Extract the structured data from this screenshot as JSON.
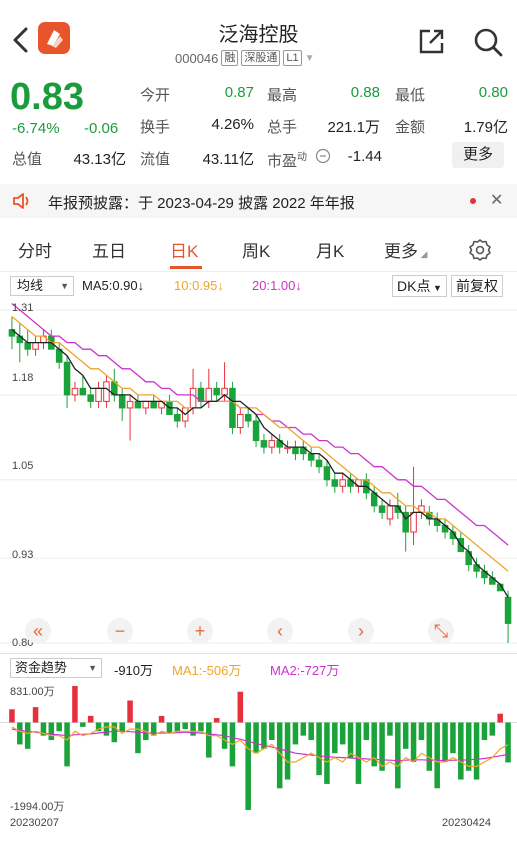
{
  "header": {
    "title": "泛海控股",
    "code": "000046",
    "tags": [
      "融",
      "深股通",
      "L1"
    ]
  },
  "quote": {
    "price": "0.83",
    "change_pct": "-6.74%",
    "change": "-0.06",
    "stats": [
      {
        "label": "今开",
        "value": "0.87",
        "color": "green"
      },
      {
        "label": "最高",
        "value": "0.88",
        "color": "green"
      },
      {
        "label": "最低",
        "value": "0.80",
        "color": "green"
      },
      {
        "label": "换手",
        "value": "4.26%"
      },
      {
        "label": "总手",
        "value": "221.1万"
      },
      {
        "label": "金额",
        "value": "1.79亿"
      },
      {
        "label": "总值",
        "value": "43.13亿"
      },
      {
        "label": "流值",
        "value": "43.11亿"
      },
      {
        "label": "市盈",
        "sup": "动",
        "value": "-1.44"
      }
    ],
    "more_label": "更多"
  },
  "notice": {
    "text": "年报预披露：于 2023-04-29 披露 2022 年年报"
  },
  "tabs": [
    "分时",
    "五日",
    "日K",
    "周K",
    "月K",
    "更多"
  ],
  "active_tab": "日K",
  "chart": {
    "indicator": "均线",
    "ma5": "MA5:0.90↓",
    "ma10": "10:0.95↓",
    "ma20": "20:1.00↓",
    "dk_label": "DK点",
    "fq_label": "前复权",
    "y_labels": [
      "1.31",
      "1.18",
      "1.05",
      "0.93",
      "0.80"
    ],
    "colors": {
      "up": "#e8303c",
      "down": "#1aa33a",
      "ma5": "#222222",
      "ma10": "#f0a52a",
      "ma20": "#cc33cc"
    }
  },
  "controls": [
    "«",
    "−",
    "+",
    "‹",
    "›",
    "⤡"
  ],
  "fund": {
    "indicator": "资金趋势",
    "value": "-910万",
    "ma1": "MA1:-506万",
    "ma2": "MA2:-727万",
    "max_label": "831.00万",
    "min_label": "-1994.00万",
    "start_date": "20230207",
    "end_date": "20230424"
  },
  "chart_data": {
    "type": "candlestick",
    "candles": [
      {
        "o": 1.28,
        "h": 1.3,
        "l": 1.25,
        "c": 1.27
      },
      {
        "o": 1.27,
        "h": 1.29,
        "l": 1.23,
        "c": 1.26
      },
      {
        "o": 1.26,
        "h": 1.28,
        "l": 1.24,
        "c": 1.25
      },
      {
        "o": 1.25,
        "h": 1.27,
        "l": 1.24,
        "c": 1.26
      },
      {
        "o": 1.26,
        "h": 1.28,
        "l": 1.25,
        "c": 1.27
      },
      {
        "o": 1.27,
        "h": 1.28,
        "l": 1.25,
        "c": 1.25
      },
      {
        "o": 1.25,
        "h": 1.26,
        "l": 1.22,
        "c": 1.23
      },
      {
        "o": 1.23,
        "h": 1.24,
        "l": 1.16,
        "c": 1.18
      },
      {
        "o": 1.18,
        "h": 1.2,
        "l": 1.17,
        "c": 1.19
      },
      {
        "o": 1.19,
        "h": 1.21,
        "l": 1.18,
        "c": 1.18
      },
      {
        "o": 1.18,
        "h": 1.19,
        "l": 1.16,
        "c": 1.17
      },
      {
        "o": 1.17,
        "h": 1.2,
        "l": 1.16,
        "c": 1.19
      },
      {
        "o": 1.17,
        "h": 1.21,
        "l": 1.16,
        "c": 1.2
      },
      {
        "o": 1.2,
        "h": 1.22,
        "l": 1.17,
        "c": 1.18
      },
      {
        "o": 1.18,
        "h": 1.19,
        "l": 1.14,
        "c": 1.16
      },
      {
        "o": 1.16,
        "h": 1.18,
        "l": 1.11,
        "c": 1.17
      },
      {
        "o": 1.17,
        "h": 1.18,
        "l": 1.16,
        "c": 1.16
      },
      {
        "o": 1.16,
        "h": 1.17,
        "l": 1.15,
        "c": 1.17
      },
      {
        "o": 1.17,
        "h": 1.18,
        "l": 1.16,
        "c": 1.16
      },
      {
        "o": 1.16,
        "h": 1.17,
        "l": 1.15,
        "c": 1.17
      },
      {
        "o": 1.17,
        "h": 1.18,
        "l": 1.15,
        "c": 1.15
      },
      {
        "o": 1.15,
        "h": 1.16,
        "l": 1.13,
        "c": 1.14
      },
      {
        "o": 1.14,
        "h": 1.16,
        "l": 1.13,
        "c": 1.16
      },
      {
        "o": 1.16,
        "h": 1.22,
        "l": 1.15,
        "c": 1.19
      },
      {
        "o": 1.19,
        "h": 1.2,
        "l": 1.16,
        "c": 1.17
      },
      {
        "o": 1.17,
        "h": 1.22,
        "l": 1.16,
        "c": 1.19
      },
      {
        "o": 1.19,
        "h": 1.2,
        "l": 1.17,
        "c": 1.18
      },
      {
        "o": 1.18,
        "h": 1.23,
        "l": 1.17,
        "c": 1.19
      },
      {
        "o": 1.19,
        "h": 1.2,
        "l": 1.12,
        "c": 1.13
      },
      {
        "o": 1.13,
        "h": 1.16,
        "l": 1.12,
        "c": 1.15
      },
      {
        "o": 1.15,
        "h": 1.16,
        "l": 1.13,
        "c": 1.14
      },
      {
        "o": 1.14,
        "h": 1.15,
        "l": 1.1,
        "c": 1.11
      },
      {
        "o": 1.11,
        "h": 1.12,
        "l": 1.09,
        "c": 1.1
      },
      {
        "o": 1.1,
        "h": 1.12,
        "l": 1.09,
        "c": 1.11
      },
      {
        "o": 1.11,
        "h": 1.12,
        "l": 1.09,
        "c": 1.1
      },
      {
        "o": 1.1,
        "h": 1.11,
        "l": 1.09,
        "c": 1.1
      },
      {
        "o": 1.1,
        "h": 1.11,
        "l": 1.08,
        "c": 1.09
      },
      {
        "o": 1.1,
        "h": 1.11,
        "l": 1.08,
        "c": 1.09
      },
      {
        "o": 1.09,
        "h": 1.1,
        "l": 1.07,
        "c": 1.08
      },
      {
        "o": 1.08,
        "h": 1.09,
        "l": 1.06,
        "c": 1.07
      },
      {
        "o": 1.07,
        "h": 1.08,
        "l": 1.04,
        "c": 1.05
      },
      {
        "o": 1.05,
        "h": 1.06,
        "l": 1.03,
        "c": 1.04
      },
      {
        "o": 1.04,
        "h": 1.06,
        "l": 1.03,
        "c": 1.05
      },
      {
        "o": 1.05,
        "h": 1.06,
        "l": 1.03,
        "c": 1.04
      },
      {
        "o": 1.04,
        "h": 1.05,
        "l": 1.03,
        "c": 1.05
      },
      {
        "o": 1.05,
        "h": 1.06,
        "l": 1.02,
        "c": 1.03
      },
      {
        "o": 1.03,
        "h": 1.04,
        "l": 1.0,
        "c": 1.01
      },
      {
        "o": 1.01,
        "h": 1.02,
        "l": 0.99,
        "c": 1.0
      },
      {
        "o": 0.99,
        "h": 1.02,
        "l": 0.98,
        "c": 1.01
      },
      {
        "o": 1.01,
        "h": 1.03,
        "l": 0.99,
        "c": 1.0
      },
      {
        "o": 1.0,
        "h": 1.01,
        "l": 0.94,
        "c": 0.97
      },
      {
        "o": 0.97,
        "h": 1.07,
        "l": 0.95,
        "c": 1.0
      },
      {
        "o": 1.0,
        "h": 1.02,
        "l": 0.99,
        "c": 1.01
      },
      {
        "o": 1.0,
        "h": 1.01,
        "l": 0.98,
        "c": 0.99
      },
      {
        "o": 0.99,
        "h": 1.0,
        "l": 0.97,
        "c": 0.98
      },
      {
        "o": 0.98,
        "h": 0.99,
        "l": 0.96,
        "c": 0.97
      },
      {
        "o": 0.97,
        "h": 0.98,
        "l": 0.95,
        "c": 0.96
      },
      {
        "o": 0.96,
        "h": 0.97,
        "l": 0.94,
        "c": 0.94
      },
      {
        "o": 0.94,
        "h": 0.95,
        "l": 0.91,
        "c": 0.92
      },
      {
        "o": 0.92,
        "h": 0.93,
        "l": 0.9,
        "c": 0.91
      },
      {
        "o": 0.91,
        "h": 0.92,
        "l": 0.89,
        "c": 0.9
      },
      {
        "o": 0.9,
        "h": 0.91,
        "l": 0.89,
        "c": 0.89
      },
      {
        "o": 0.89,
        "h": 0.89,
        "l": 0.88,
        "c": 0.88
      },
      {
        "o": 0.87,
        "h": 0.88,
        "l": 0.8,
        "c": 0.83
      }
    ],
    "ma5": [
      1.28,
      1.27,
      1.26,
      1.26,
      1.26,
      1.26,
      1.25,
      1.24,
      1.22,
      1.21,
      1.19,
      1.19,
      1.19,
      1.18,
      1.18,
      1.18,
      1.17,
      1.17,
      1.17,
      1.17,
      1.16,
      1.16,
      1.15,
      1.16,
      1.16,
      1.17,
      1.17,
      1.18,
      1.17,
      1.17,
      1.16,
      1.15,
      1.13,
      1.12,
      1.11,
      1.1,
      1.1,
      1.1,
      1.09,
      1.09,
      1.08,
      1.06,
      1.06,
      1.05,
      1.04,
      1.04,
      1.03,
      1.02,
      1.01,
      1.01,
      0.99,
      1.0,
      1.0,
      0.99,
      0.99,
      0.98,
      0.97,
      0.95,
      0.94,
      0.92,
      0.91,
      0.9,
      0.89,
      0.87
    ],
    "ma10": [
      1.3,
      1.29,
      1.28,
      1.27,
      1.27,
      1.26,
      1.26,
      1.25,
      1.24,
      1.23,
      1.22,
      1.22,
      1.21,
      1.2,
      1.19,
      1.19,
      1.18,
      1.18,
      1.18,
      1.17,
      1.17,
      1.17,
      1.16,
      1.16,
      1.16,
      1.17,
      1.17,
      1.17,
      1.17,
      1.16,
      1.16,
      1.16,
      1.15,
      1.14,
      1.13,
      1.13,
      1.12,
      1.11,
      1.1,
      1.1,
      1.09,
      1.08,
      1.07,
      1.06,
      1.05,
      1.05,
      1.04,
      1.03,
      1.03,
      1.02,
      1.01,
      1.01,
      1.0,
      1.0,
      0.99,
      0.99,
      0.98,
      0.97,
      0.96,
      0.95,
      0.94,
      0.93,
      0.92,
      0.91
    ],
    "ma20": [
      1.32,
      1.31,
      1.3,
      1.29,
      1.28,
      1.27,
      1.27,
      1.26,
      1.26,
      1.25,
      1.25,
      1.24,
      1.24,
      1.23,
      1.22,
      1.22,
      1.21,
      1.2,
      1.2,
      1.19,
      1.19,
      1.18,
      1.18,
      1.18,
      1.17,
      1.17,
      1.17,
      1.17,
      1.17,
      1.16,
      1.16,
      1.15,
      1.15,
      1.14,
      1.14,
      1.13,
      1.13,
      1.12,
      1.12,
      1.11,
      1.11,
      1.1,
      1.1,
      1.09,
      1.09,
      1.08,
      1.07,
      1.07,
      1.06,
      1.05,
      1.05,
      1.04,
      1.04,
      1.03,
      1.02,
      1.02,
      1.01,
      1.0,
      0.99,
      0.98,
      0.98,
      0.97,
      0.96,
      0.95
    ],
    "ylim": [
      0.8,
      1.31
    ],
    "fund_flow": [
      300,
      -500,
      -600,
      350,
      -300,
      -400,
      -200,
      -1000,
      831,
      -100,
      150,
      -200,
      -300,
      -450,
      -200,
      500,
      -700,
      -400,
      -300,
      150,
      -250,
      -200,
      -150,
      -300,
      -200,
      -800,
      100,
      -600,
      -1000,
      700,
      -1994,
      -700,
      -600,
      -400,
      -1500,
      -1300,
      -500,
      -300,
      -400,
      -1200,
      -1400,
      -700,
      -500,
      -800,
      -1400,
      -400,
      -1000,
      -1100,
      -300,
      -1500,
      -600,
      -900,
      -400,
      -1100,
      -1500,
      -900,
      -700,
      -1300,
      -1100,
      -1300,
      -400,
      -300,
      200,
      -910
    ],
    "fund_ma1": [
      -100,
      -200,
      -250,
      -200,
      -250,
      -300,
      -300,
      -400,
      -200,
      -300,
      -250,
      -150,
      -100,
      -100,
      -250,
      -150,
      -150,
      -200,
      -300,
      -200,
      -250,
      -200,
      -200,
      -200,
      -200,
      -300,
      -300,
      -400,
      -500,
      -400,
      -600,
      -700,
      -600,
      -500,
      -700,
      -900,
      -900,
      -800,
      -700,
      -800,
      -900,
      -800,
      -900,
      -700,
      -800,
      -900,
      -800,
      -1000,
      -900,
      -1000,
      -800,
      -900,
      -700,
      -800,
      -900,
      -900,
      -800,
      -900,
      -1000,
      -1000,
      -900,
      -800,
      -600,
      -506
    ],
    "fund_ma2": [
      -150,
      -180,
      -200,
      -220,
      -250,
      -270,
      -280,
      -300,
      -280,
      -270,
      -260,
      -240,
      -220,
      -200,
      -200,
      -210,
      -220,
      -230,
      -250,
      -240,
      -240,
      -230,
      -220,
      -230,
      -240,
      -260,
      -280,
      -300,
      -350,
      -380,
      -430,
      -480,
      -520,
      -560,
      -600,
      -650,
      -700,
      -720,
      -740,
      -760,
      -780,
      -790,
      -800,
      -810,
      -820,
      -830,
      -840,
      -850,
      -860,
      -870,
      -860,
      -850,
      -850,
      -860,
      -860,
      -870,
      -860,
      -860,
      -850,
      -840,
      -820,
      -790,
      -760,
      -727
    ],
    "fund_ylim": [
      -1994,
      831
    ]
  }
}
